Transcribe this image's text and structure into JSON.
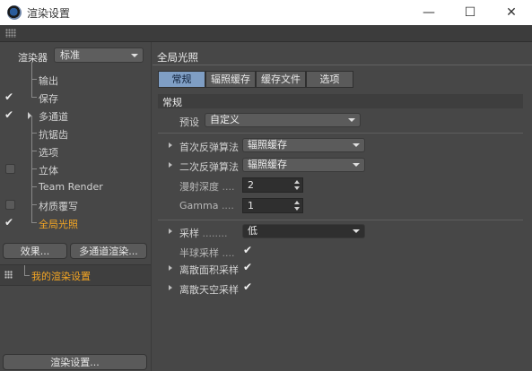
{
  "window": {
    "title": "渲染设置",
    "min_glyph": "—",
    "max_glyph": "☐",
    "close_glyph": "✕"
  },
  "left": {
    "renderer_label": "渲染器",
    "renderer_value": "标准",
    "tree": [
      {
        "label": "输出",
        "check": "none",
        "active": false
      },
      {
        "label": "保存",
        "check": "checked",
        "active": false
      },
      {
        "label": "多通道",
        "check": "checked",
        "active": false,
        "expander": true
      },
      {
        "label": "抗锯齿",
        "check": "none",
        "active": false
      },
      {
        "label": "选项",
        "check": "none",
        "active": false
      },
      {
        "label": "立体",
        "check": "box",
        "active": false
      },
      {
        "label": "Team Render",
        "check": "none",
        "active": false
      },
      {
        "label": "材质覆写",
        "check": "box",
        "active": false
      },
      {
        "label": "全局光照",
        "check": "checked",
        "active": true
      }
    ],
    "effects_button": "效果...",
    "multipass_button": "多通道渲染...",
    "render_setting_name": "我的渲染设置",
    "render_settings_button": "渲染设置..."
  },
  "right": {
    "section_title": "全局光照",
    "tabs": [
      "常规",
      "辐照缓存",
      "缓存文件",
      "选项"
    ],
    "active_tab": 0,
    "group_title": "常规",
    "preset_label": "预设",
    "preset_value": "自定义",
    "primary_label": "首次反弹算法",
    "primary_value": "辐照缓存",
    "secondary_label": "二次反弹算法",
    "secondary_value": "辐照缓存",
    "diffuse_depth_label": "漫射深度",
    "diffuse_depth_dots": "....",
    "diffuse_depth_value": "2",
    "gamma_label": "Gamma",
    "gamma_dots": "....",
    "gamma_value": "1",
    "sampling_label": "采样",
    "sampling_dots": "........",
    "sampling_value": "低",
    "hemi_label": "半球采样",
    "hemi_dots": "....",
    "hemi_checked": true,
    "area_label": "离散面积采样",
    "area_checked": true,
    "sky_label": "离散天空采样",
    "sky_checked": true,
    "check_glyph": "✔"
  }
}
